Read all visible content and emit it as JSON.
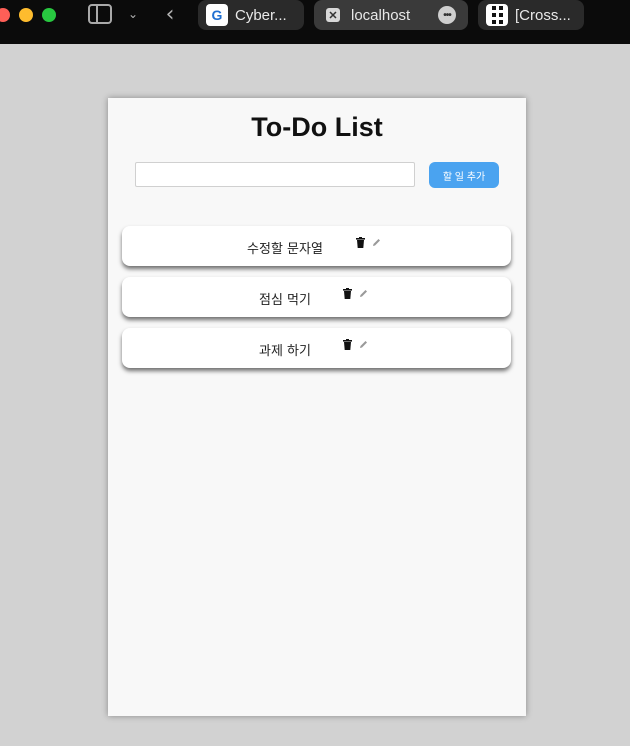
{
  "browser": {
    "tabs": [
      {
        "title": "Cyber...",
        "favicon": "cybercampus-g-icon"
      },
      {
        "title": "localhost",
        "favicon": "close-tab-icon",
        "active": true
      },
      {
        "title": "[Cross...",
        "favicon": "crossref-grid-icon"
      }
    ],
    "favicon_letters": {
      "cyber": "G",
      "local": "✕"
    },
    "more_glyph": "•••",
    "chev_glyph": "⌄",
    "back_glyph": "‹"
  },
  "app": {
    "title": "To-Do List",
    "input_value": "",
    "input_placeholder": "",
    "add_button_label": "할 일 추가",
    "todos": [
      {
        "text": "수정할 문자열"
      },
      {
        "text": "점심 먹기"
      },
      {
        "text": "과제 하기"
      }
    ]
  },
  "colors": {
    "page_bg": "#d2d2d2",
    "card_bg": "#f8f8f8",
    "accent": "#4aa3f0",
    "chrome_bg": "#0b0b0b"
  }
}
